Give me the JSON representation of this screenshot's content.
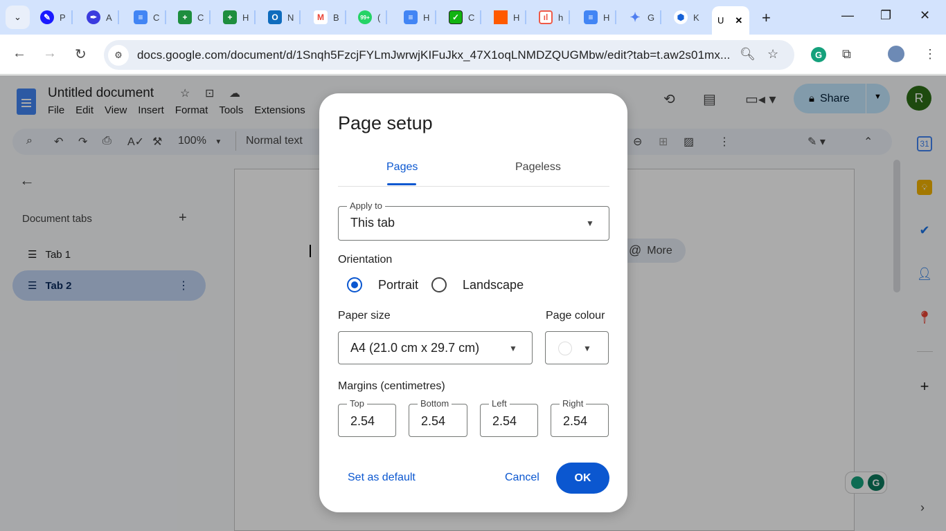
{
  "browser": {
    "tabs": [
      {
        "icon": "quill-icon",
        "label": "P",
        "color": "#1a1aff"
      },
      {
        "icon": "pen-icon",
        "label": "A",
        "color": "#3b3bde"
      },
      {
        "icon": "docs-icon",
        "label": "C",
        "color": "#4285f4"
      },
      {
        "icon": "sheets-icon",
        "label": "C",
        "color": "#1e8e3e"
      },
      {
        "icon": "sheets-icon",
        "label": "H",
        "color": "#1e8e3e"
      },
      {
        "icon": "outlook-icon",
        "label": "N",
        "color": "#0f6cbd"
      },
      {
        "icon": "gmail-icon",
        "label": "B",
        "color": "#ea4335"
      },
      {
        "icon": "whatsapp-icon",
        "label": "(",
        "color": "#25d366",
        "badge": "99+"
      },
      {
        "icon": "docs-icon",
        "label": "H",
        "color": "#4285f4"
      },
      {
        "icon": "checkbox-icon",
        "label": "C",
        "color": "#12b312"
      },
      {
        "icon": "orange-square-icon",
        "label": "H",
        "color": "#ff5a00"
      },
      {
        "icon": "chart-icon",
        "label": "h",
        "color": "#ef5a48"
      },
      {
        "icon": "docs-icon",
        "label": "H",
        "color": "#4285f4"
      },
      {
        "icon": "gemini-icon",
        "label": "G",
        "color": "#4f7ef0"
      },
      {
        "icon": "hexagon-icon",
        "label": "K",
        "color": "#1661d6"
      }
    ],
    "active_tab_label": "U",
    "url": "docs.google.com/document/d/1Snqh5FzcjFYLmJwrwjKIFuJkx_47X1oqLNMDZQUGMbw/edit?tab=t.aw2s01mx..."
  },
  "docs": {
    "title": "Untitled document",
    "menu": [
      "File",
      "Edit",
      "View",
      "Insert",
      "Format",
      "Tools",
      "Extensions"
    ],
    "zoom": "100%",
    "style": "Normal text",
    "share_label": "Share",
    "avatar_letter": "R",
    "sidebar": {
      "heading": "Document tabs",
      "tabs": [
        {
          "label": "Tab 1",
          "selected": false
        },
        {
          "label": "Tab 2",
          "selected": true
        }
      ]
    },
    "chip_label": "More"
  },
  "dialog": {
    "title": "Page setup",
    "tabs": [
      {
        "label": "Pages",
        "active": true
      },
      {
        "label": "Pageless",
        "active": false
      }
    ],
    "apply_to": {
      "label": "Apply to",
      "value": "This tab"
    },
    "orientation": {
      "label": "Orientation",
      "options": [
        {
          "label": "Portrait",
          "selected": true
        },
        {
          "label": "Landscape",
          "selected": false
        }
      ]
    },
    "paper_size": {
      "label": "Paper size",
      "value": "A4 (21.0 cm x 29.7 cm)"
    },
    "page_colour": {
      "label": "Page colour",
      "value": "#ffffff"
    },
    "margins": {
      "label": "Margins (centimetres)",
      "fields": [
        {
          "label": "Top",
          "value": "2.54"
        },
        {
          "label": "Bottom",
          "value": "2.54"
        },
        {
          "label": "Left",
          "value": "2.54"
        },
        {
          "label": "Right",
          "value": "2.54"
        }
      ]
    },
    "set_default_label": "Set as default",
    "cancel_label": "Cancel",
    "ok_label": "OK"
  }
}
